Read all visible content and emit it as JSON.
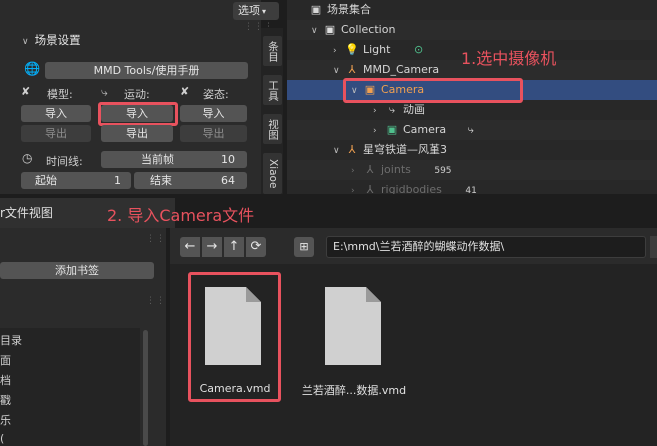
{
  "left_panel": {
    "options_label": "选项",
    "section_title": "场景设置",
    "manual_button": "MMD Tools/使用手册",
    "model_label": "模型:",
    "motion_label": "运动:",
    "pose_label": "姿态:",
    "import_label": "导入",
    "export_label": "导出",
    "timeline_label": "时间线:",
    "current_frame_label": "当前帧",
    "current_frame_value": "10",
    "start_label": "起始",
    "start_value": "1",
    "end_label": "结束",
    "end_value": "64"
  },
  "vertical_tabs": [
    "条目",
    "工具",
    "视图",
    "Xiaoe"
  ],
  "outliner": {
    "root": "场景集合",
    "collection": "Collection",
    "light": "Light",
    "mmd_camera": "MMD_Camera",
    "camera_selected": "Camera",
    "anim": "动画",
    "camera_data": "Camera",
    "star_rail": "星穹铁道—风堇3",
    "joints": "joints",
    "joints_count": "595",
    "rigidbodies": "rigidbodies",
    "rigidbodies_count": "41"
  },
  "annotations": {
    "step1": "1.选中摄像机",
    "step2": "2. 导入Camera文件"
  },
  "file_browser": {
    "title": "r文件视图",
    "add_bookmark": "添加书签",
    "path": "E:\\mmd\\兰若酒醉的蝴蝶动作数据\\",
    "sidebar_items": [
      "目录",
      "面",
      "档",
      "戳",
      "乐",
      "("
    ],
    "files": [
      {
        "name": "Camera.vmd"
      },
      {
        "name": "兰若酒醉...数据.vmd"
      }
    ]
  },
  "colors": {
    "accent_red": "#e8525e",
    "selection_blue": "#334d80",
    "camera_orange": "#f0a050"
  }
}
